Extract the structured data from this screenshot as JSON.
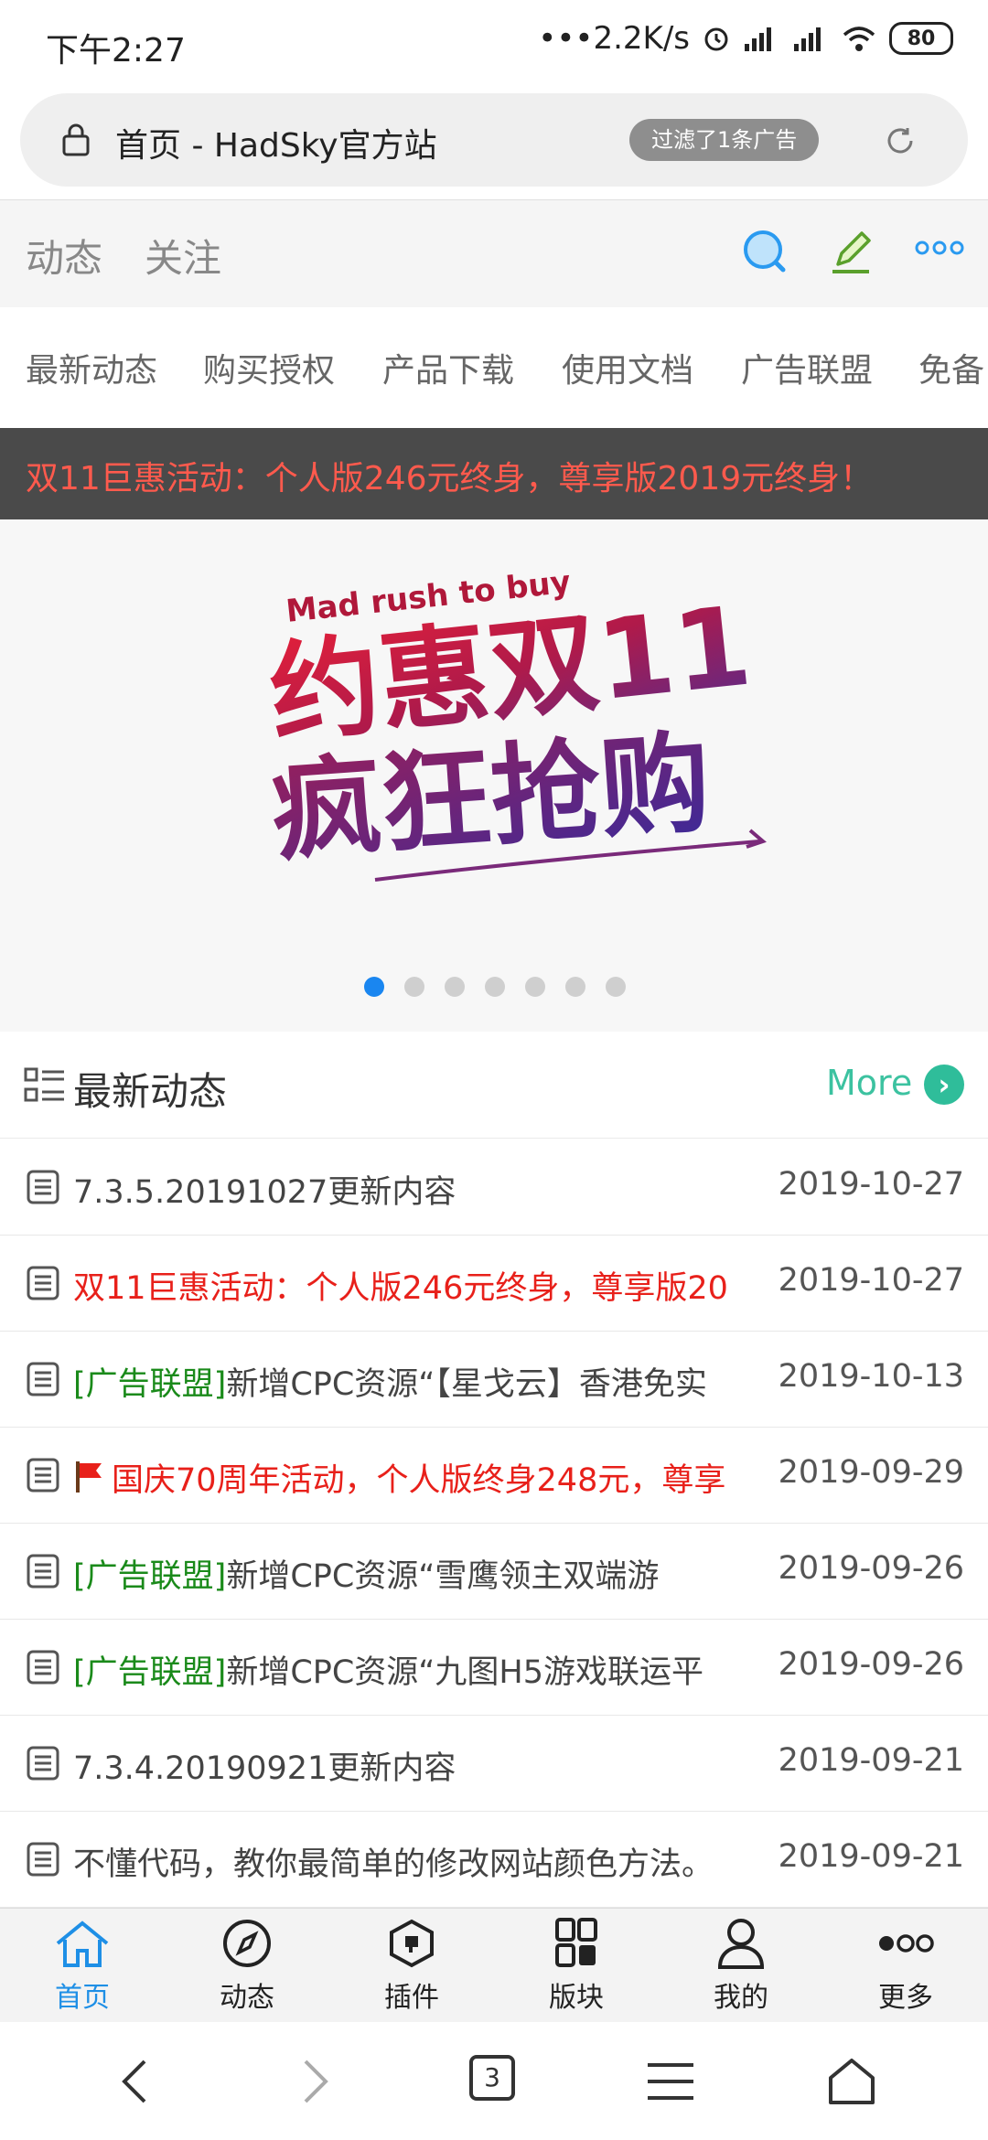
{
  "status_bar": {
    "time": "下午2:27",
    "network_speed": "•••2.2K/s",
    "battery": "80"
  },
  "browser": {
    "page_title": "首页 - HadSky官方站",
    "ad_filter_badge": "过滤了1条广告"
  },
  "top_nav": {
    "tabs": [
      "动态",
      "关注"
    ],
    "icons": [
      "search-icon",
      "edit-icon",
      "more-icon"
    ]
  },
  "category_nav": [
    "最新动态",
    "购买授权",
    "产品下载",
    "使用文档",
    "广告联盟",
    "免备"
  ],
  "announcement": "双11巨惠活动：个人版246元终身，尊享版2019元终身！",
  "banner": {
    "en_text": "Mad rush to buy",
    "line1": "约惠双11",
    "line2": "疯狂抢购",
    "dots_count": 7,
    "active_dot": 0
  },
  "section": {
    "title": "最新动态",
    "more_label": "More"
  },
  "news": [
    {
      "prefix": "",
      "prefix_color": "",
      "title": "7.3.5.20191027更新内容",
      "title_color": "default",
      "flag": false,
      "date": "2019-10-27"
    },
    {
      "prefix": "",
      "prefix_color": "",
      "title": "双11巨惠活动：个人版246元终身，尊享版20",
      "title_color": "red",
      "flag": false,
      "date": "2019-10-27"
    },
    {
      "prefix": "[广告联盟]",
      "prefix_color": "green",
      "title": "新增CPC资源“【星戈云】香港免实",
      "title_color": "default",
      "flag": false,
      "date": "2019-10-13"
    },
    {
      "prefix": "",
      "prefix_color": "",
      "title": "国庆70周年活动，个人版终身248元，尊享",
      "title_color": "red",
      "flag": true,
      "date": "2019-09-29"
    },
    {
      "prefix": "[广告联盟]",
      "prefix_color": "green",
      "title": "新增CPC资源“雪鹰领主双端游",
      "title_color": "default",
      "flag": false,
      "date": "2019-09-26"
    },
    {
      "prefix": "[广告联盟]",
      "prefix_color": "green",
      "title": "新增CPC资源“九图H5游戏联运平",
      "title_color": "default",
      "flag": false,
      "date": "2019-09-26"
    },
    {
      "prefix": "",
      "prefix_color": "",
      "title": "7.3.4.20190921更新内容",
      "title_color": "default",
      "flag": false,
      "date": "2019-09-21"
    },
    {
      "prefix": "",
      "prefix_color": "",
      "title": "不懂代码，教你最简单的修改网站颜色方法。",
      "title_color": "default",
      "flag": false,
      "date": "2019-09-21"
    }
  ],
  "tab_bar": [
    {
      "label": "首页",
      "icon": "home-icon",
      "active": true
    },
    {
      "label": "动态",
      "icon": "compass-icon",
      "active": false
    },
    {
      "label": "插件",
      "icon": "plugin-icon",
      "active": false
    },
    {
      "label": "版块",
      "icon": "grid-icon",
      "active": false
    },
    {
      "label": "我的",
      "icon": "user-icon",
      "active": false
    },
    {
      "label": "更多",
      "icon": "more-dots-icon",
      "active": false
    }
  ],
  "system_nav": {
    "tab_count": "3",
    "icons": [
      "back-icon",
      "forward-icon",
      "tabs-icon",
      "menu-icon",
      "home-icon"
    ]
  },
  "colors": {
    "accent_blue": "#1e8fe6",
    "accent_green": "#2fbd9a",
    "announce_red": "#ff5a4d",
    "title_red": "#e8201a",
    "prefix_green": "#1a8a1a"
  }
}
